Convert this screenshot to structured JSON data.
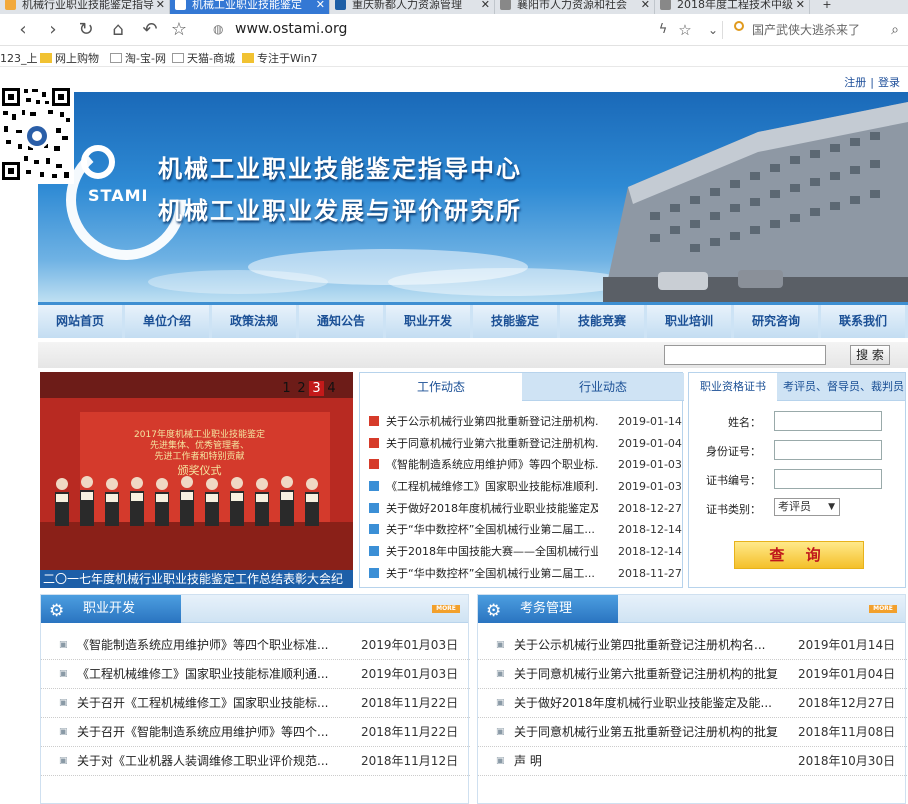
{
  "browser": {
    "tabs": [
      {
        "label": "机械行业职业技能鉴定指导",
        "active": false
      },
      {
        "label": "机械工业职业技能鉴定",
        "active": true
      },
      {
        "label": "重庆新都人力资源管理",
        "active": false
      },
      {
        "label": "襄阳市人力资源和社会",
        "active": false
      },
      {
        "label": "2018年度工程技术中级",
        "active": false
      }
    ],
    "new_tab": "+",
    "url": "www.ostami.org",
    "search_placeholder": "国产武侠大逃杀来了",
    "bookmarks": [
      "123_上",
      "网上购物",
      "淘-宝-网",
      "天猫-商城",
      "专注于Win7"
    ]
  },
  "site": {
    "top_links": {
      "register": "注册",
      "sep": "|",
      "login": "登录"
    },
    "banner": {
      "title1": "机械工业职业技能鉴定指导中心",
      "title2": "机械工业职业发展与评价研究所",
      "logo_text": "STAMI"
    },
    "nav": [
      "网站首页",
      "单位介绍",
      "政策法规",
      "通知公告",
      "职业开发",
      "技能鉴定",
      "技能竞赛",
      "职业培训",
      "研究咨询",
      "联系我们"
    ],
    "search_button": "搜 索",
    "slideshow": {
      "pages": [
        "1",
        "2",
        "3",
        "4"
      ],
      "current": "3",
      "stage_line1": "2017年度机械工业职业技能鉴定",
      "stage_line2": "先进集体、优秀管理者、",
      "stage_line3": "先进工作者和特别贡献",
      "stage_line4": "颁奖仪式",
      "caption": "二〇一七年度机械行业职业技能鉴定工作总结表彰大会纪"
    },
    "news": {
      "tabs": [
        "工作动态",
        "行业动态"
      ],
      "items": [
        {
          "title": "关于公示机械行业第四批重新登记注册机构...",
          "date": "2019-01-14",
          "color": "#d63b2a"
        },
        {
          "title": "关于同意机械行业第六批重新登记注册机构...",
          "date": "2019-01-04",
          "color": "#d63b2a"
        },
        {
          "title": "《智能制造系统应用维护师》等四个职业标...",
          "date": "2019-01-03",
          "color": "#d63b2a"
        },
        {
          "title": "《工程机械维修工》国家职业技能标准顺利...",
          "date": "2019-01-03",
          "color": "#3b8fd6"
        },
        {
          "title": "关于做好2018年度机械行业职业技能鉴定及...",
          "date": "2018-12-27",
          "color": "#3b8fd6"
        },
        {
          "title": "关于“华中数控杯”全国机械行业第二届工...",
          "date": "2018-12-14",
          "color": "#3b8fd6"
        },
        {
          "title": "关于2018年中国技能大赛——全国机械行业...",
          "date": "2018-12-14",
          "color": "#3b8fd6"
        },
        {
          "title": "关于“华中数控杯”全国机械行业第二届工...",
          "date": "2018-11-27",
          "color": "#3b8fd6"
        }
      ]
    },
    "cert": {
      "tabs": [
        "职业资格证书",
        "考评员、督导员、裁判员"
      ],
      "fields": [
        "姓名：",
        "身份证号：",
        "证书编号：",
        "证书类别："
      ],
      "category_value": "考评员",
      "query_button": "查 询"
    },
    "boxes": {
      "left": {
        "title": "职业开发",
        "more": "MORE",
        "items": [
          {
            "title": "《智能制造系统应用维护师》等四个职业标准...",
            "date": "2019年01月03日"
          },
          {
            "title": "《工程机械维修工》国家职业技能标准顺利通...",
            "date": "2019年01月03日"
          },
          {
            "title": "关于召开《工程机械维修工》国家职业技能标...",
            "date": "2018年11月22日"
          },
          {
            "title": "关于召开《智能制造系统应用维护师》等四个...",
            "date": "2018年11月22日"
          },
          {
            "title": "关于对《工业机器人装调维修工职业评价规范...",
            "date": "2018年11月12日"
          }
        ]
      },
      "right": {
        "title": "考务管理",
        "more": "MORE",
        "items": [
          {
            "title": "关于公示机械行业第四批重新登记注册机构名...",
            "date": "2019年01月14日"
          },
          {
            "title": "关于同意机械行业第六批重新登记注册机构的批复",
            "date": "2019年01月04日"
          },
          {
            "title": "关于做好2018年度机械行业职业技能鉴定及能...",
            "date": "2018年12月27日"
          },
          {
            "title": "关于同意机械行业第五批重新登记注册机构的批复",
            "date": "2018年11月08日"
          },
          {
            "title": "声 明",
            "date": "2018年10月30日"
          }
        ]
      }
    }
  }
}
